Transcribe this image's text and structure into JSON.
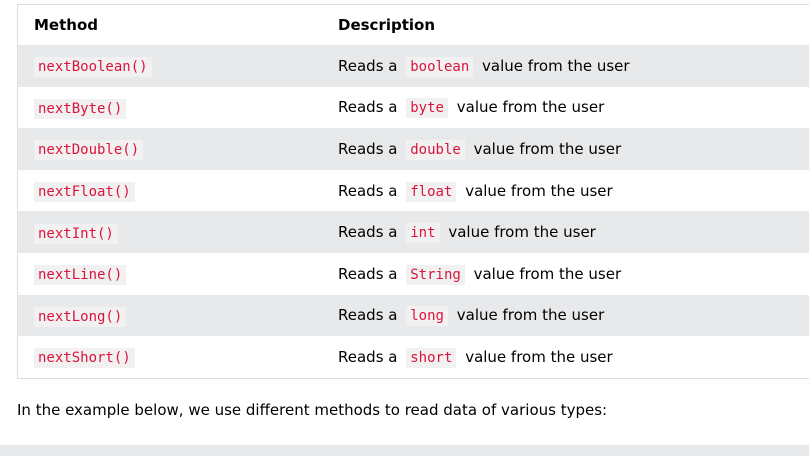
{
  "table": {
    "headers": {
      "method": "Method",
      "description": "Description"
    },
    "rows": [
      {
        "method": "nextBoolean()",
        "prefix": "Reads a",
        "type": "boolean",
        "suffix": "value from the user"
      },
      {
        "method": "nextByte()",
        "prefix": "Reads a",
        "type": "byte",
        "suffix": "value from the user"
      },
      {
        "method": "nextDouble()",
        "prefix": "Reads a",
        "type": "double",
        "suffix": "value from the user"
      },
      {
        "method": "nextFloat()",
        "prefix": "Reads a",
        "type": "float",
        "suffix": "value from the user"
      },
      {
        "method": "nextInt()",
        "prefix": "Reads a",
        "type": "int",
        "suffix": "value from the user"
      },
      {
        "method": "nextLine()",
        "prefix": "Reads a",
        "type": "String",
        "suffix": "value from the user"
      },
      {
        "method": "nextLong()",
        "prefix": "Reads a",
        "type": "long",
        "suffix": "value from the user"
      },
      {
        "method": "nextShort()",
        "prefix": "Reads a",
        "type": "short",
        "suffix": "value from the user"
      }
    ]
  },
  "intro_text": "In the example below, we use different methods to read data of various types:",
  "colors": {
    "code_text": "#dc143c",
    "stripe": "#e7e9eb"
  }
}
